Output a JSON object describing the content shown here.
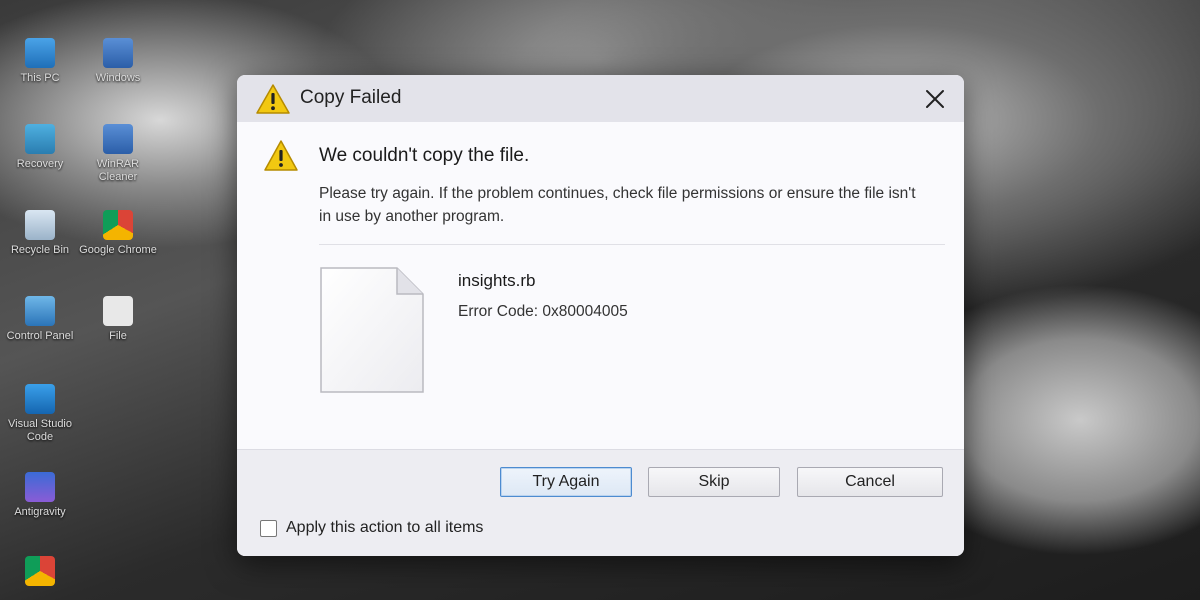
{
  "desktop": {
    "icons": [
      {
        "label": "This PC"
      },
      {
        "label": "Windows"
      },
      {
        "label": "Recovery"
      },
      {
        "label": "WinRAR Cleaner"
      },
      {
        "label": "Recycle Bin"
      },
      {
        "label": "Google Chrome"
      },
      {
        "label": "Control Panel"
      },
      {
        "label": "File"
      },
      {
        "label": "Visual Studio Code"
      },
      {
        "label": "Antigravity"
      }
    ]
  },
  "dialog": {
    "title": "Copy Failed",
    "close_icon": "close-icon",
    "heading": "We couldn't copy the file.",
    "description": "Please try again. If the problem continues, check file permissions or ensure the file isn't in use by another program.",
    "file": {
      "name": "insights.rb",
      "error_code": "Error Code: 0x80004005"
    },
    "buttons": {
      "try_again": "Try Again",
      "skip": "Skip",
      "cancel": "Cancel"
    },
    "checkbox": {
      "label": "Apply this action to all items",
      "checked": false
    },
    "colors": {
      "warning": "#f2c811",
      "primary_border": "#4d8bd0"
    }
  }
}
